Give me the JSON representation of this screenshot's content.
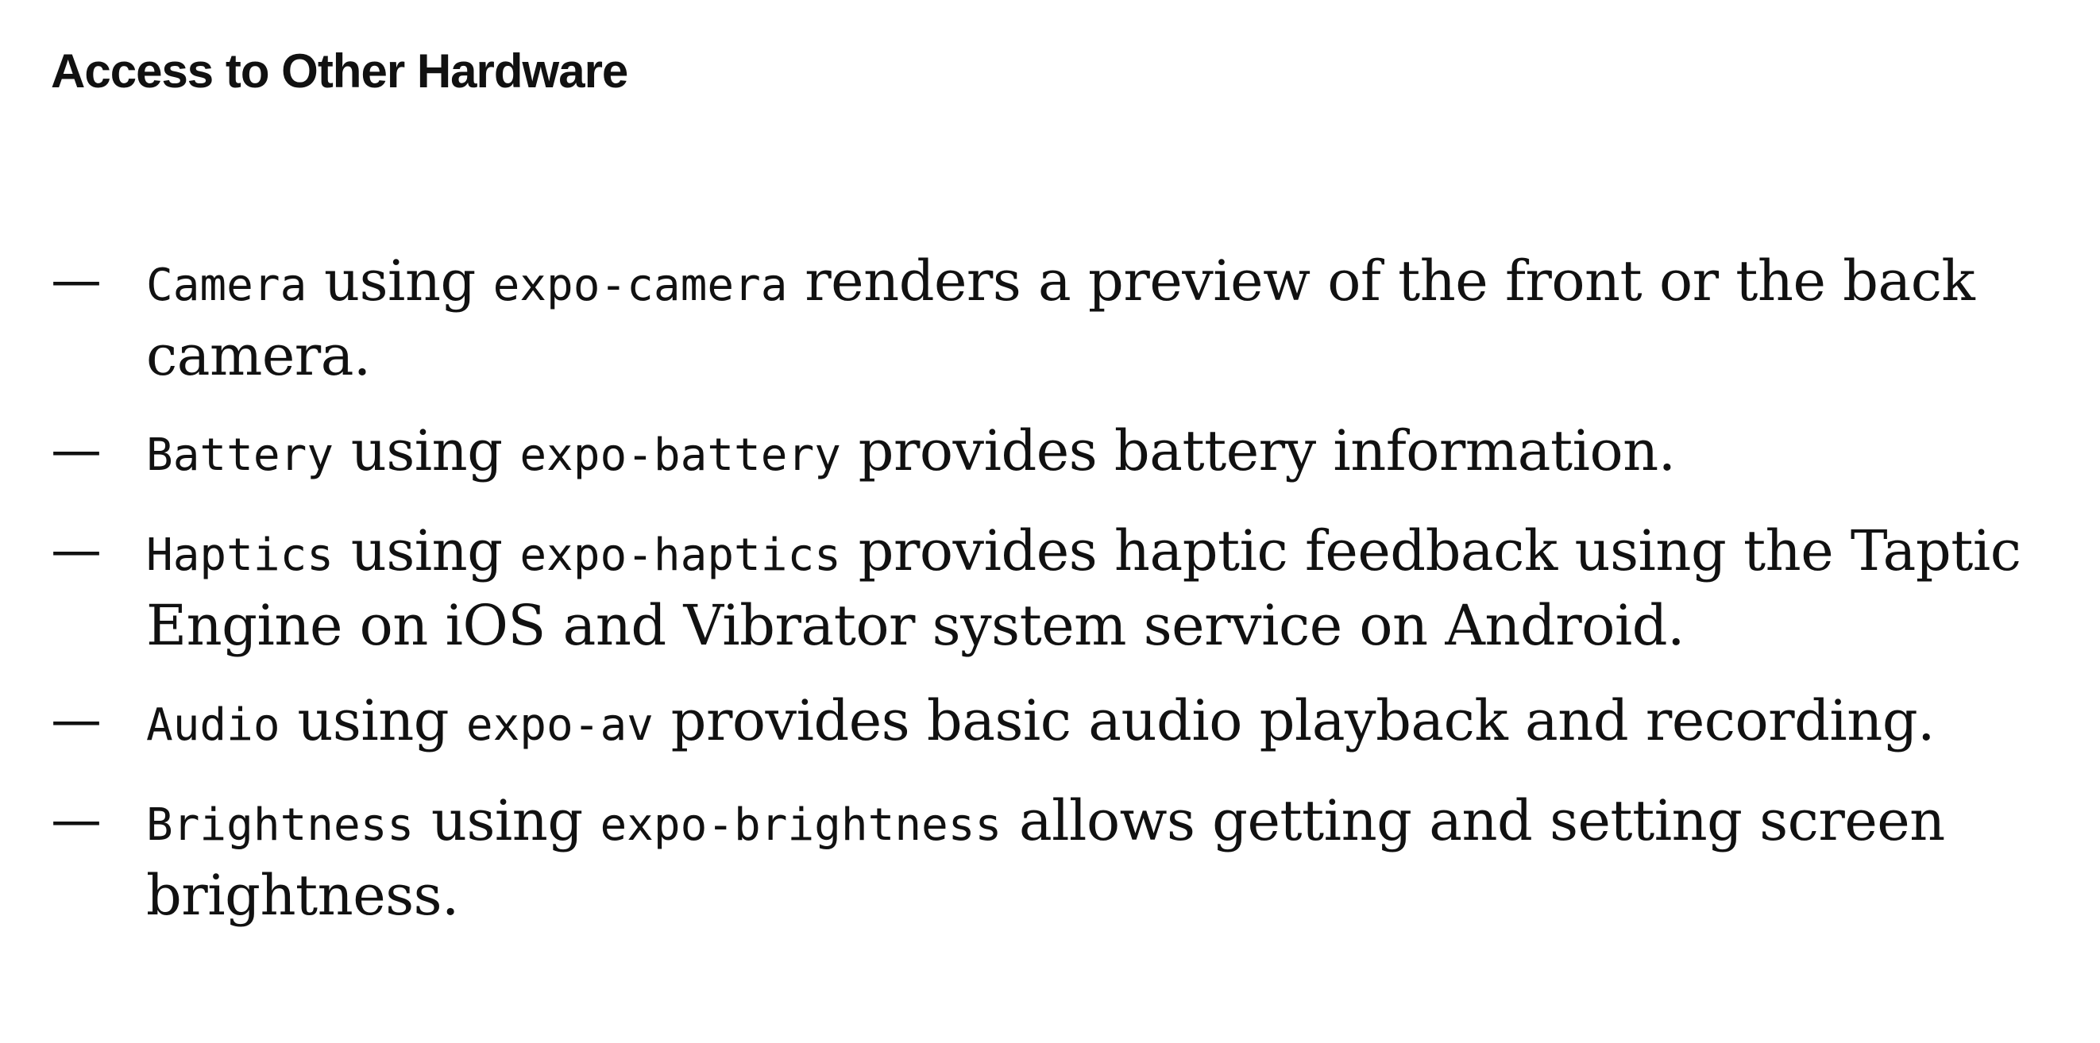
{
  "slide": {
    "title": "Access to Other Hardware",
    "dash": "—",
    "items": [
      {
        "api": "Camera",
        "using": " using ",
        "package": "expo-camera",
        "description": " renders a preview of the front or the back camera."
      },
      {
        "api": "Battery",
        "using": " using ",
        "package": "expo-battery",
        "description": " provides battery information."
      },
      {
        "api": "Haptics",
        "using": " using ",
        "package": "expo-haptics",
        "description": " provides haptic feedback using the Taptic Engine on iOS and Vibrator system service on Android."
      },
      {
        "api": "Audio",
        "using": " using ",
        "package": "expo-av",
        "description": " provides basic audio playback and recording."
      },
      {
        "api": "Brightness",
        "using": " using ",
        "package": "expo-brightness",
        "description": " allows getting and setting screen brightness."
      }
    ]
  }
}
